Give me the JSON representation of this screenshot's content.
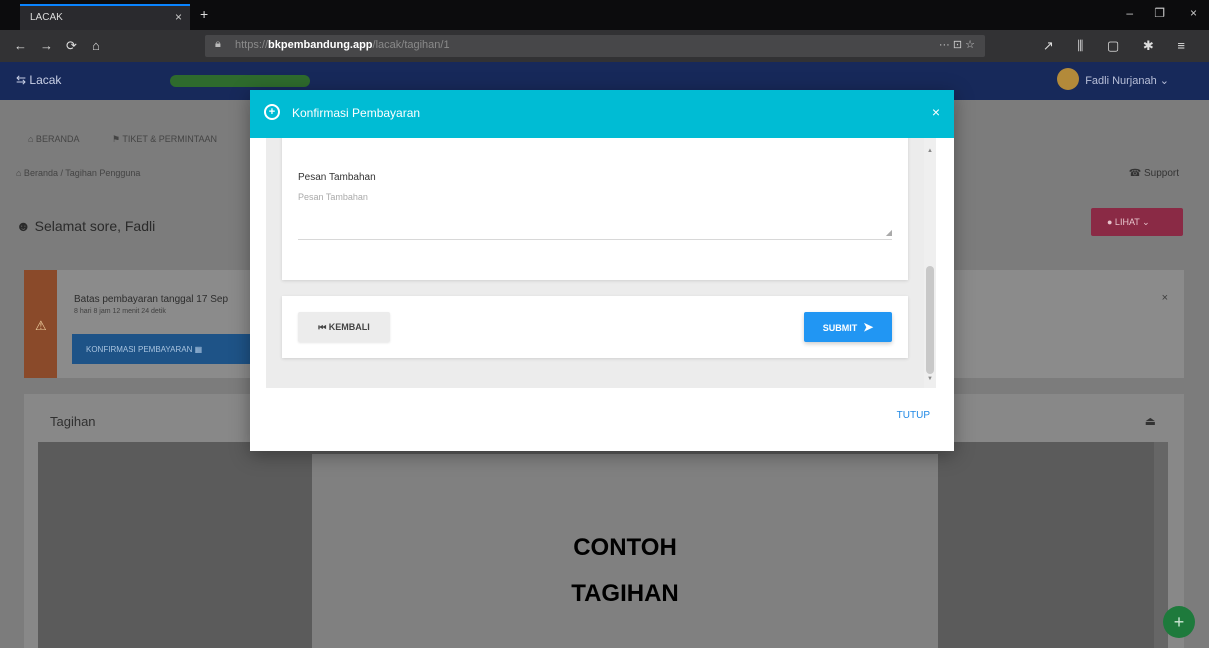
{
  "browser": {
    "tab_title": "LACAK",
    "tab_close": "×",
    "new_tab": "+",
    "url_prefix": "https://",
    "url_domain": "bkpembandung.app",
    "url_path": "/lacak/tagihan/1",
    "page_actions": "··· ⊡ ☆",
    "win_min": "–",
    "win_max": "❐",
    "win_close": "×",
    "nav_back": "←",
    "nav_forward": "→",
    "nav_reload": "⟳",
    "nav_home": "⌂",
    "toolbar_icons": "↗ ⫼ ▢ ✱ ≡"
  },
  "app": {
    "logo": "⇆ Lacak",
    "user_name": "Fadli Nurjanah ⌄"
  },
  "page": {
    "menu": [
      "⌂ BERANDA",
      "⚑ TIKET & PERMINTAAN"
    ],
    "breadcrumb": "⌂ Beranda / Tagihan Pengguna",
    "support": "☎ Support",
    "greeting": "☻ Selamat sore, Fadli",
    "lihat": "● LIHAT ⌄"
  },
  "alert": {
    "icon": "⚠",
    "title": "Batas pembayaran tanggal 17 Sep",
    "subtitle": "8 hari 8 jam 12 menit 24 detik",
    "button": "KONFIRMASI PEMBAYARAN ▦",
    "close": "×"
  },
  "tagihan": {
    "title": "Tagihan",
    "download": "⏏",
    "doc_line1": "CONTOH",
    "doc_line2": "TAGIHAN",
    "fab": "+"
  },
  "modal": {
    "icon": "+",
    "title": "Konfirmasi Pembayaran",
    "close": "×",
    "note_label": "Pesan Tambahan",
    "note_placeholder": "Pesan Tambahan",
    "note_value": "",
    "back_label": "⏮ KEMBALI",
    "submit_label": "SUBMIT",
    "submit_icon": "➤",
    "tutup_label": "TUTUP"
  },
  "colors": {
    "modal_header": "#00bcd4",
    "submit": "#2196f3",
    "tutup": "#1e88e5"
  }
}
